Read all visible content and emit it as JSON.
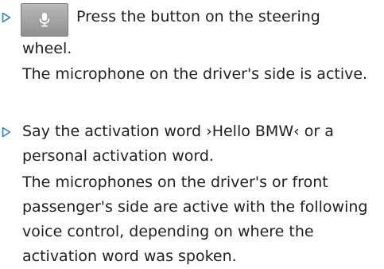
{
  "steps": [
    {
      "action": "Press the button on the steering wheel.",
      "result": "The microphone on the driver's side is active.",
      "icon": "microphone-icon"
    },
    {
      "action": "Say the activation word ›Hello BMW‹ or a personal activation word.",
      "result": "The microphones on the driver's or front passenger's side are active with the following voice control, depending on where the activation word was spoken."
    }
  ],
  "colors": {
    "bullet": "#2a7fbf",
    "text": "#1f1f1f",
    "button": "#a3a3a3"
  }
}
